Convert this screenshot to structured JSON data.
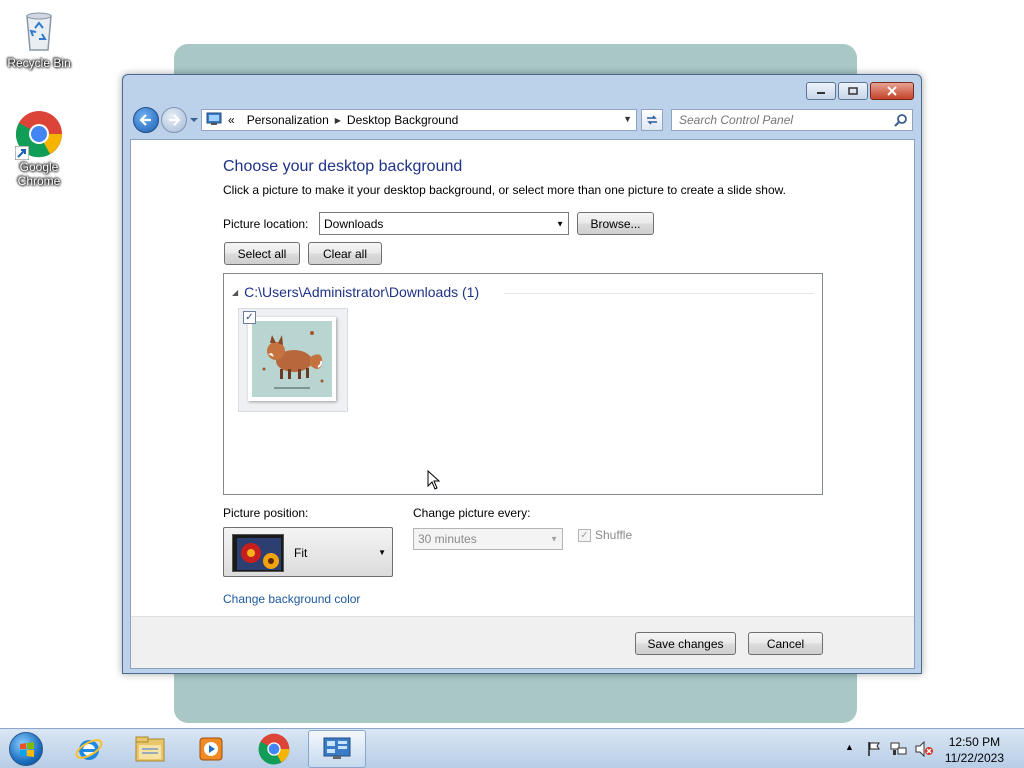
{
  "desktop": {
    "icons": [
      {
        "label": "Recycle Bin",
        "icon": "recycle-bin-icon"
      },
      {
        "label": "Google Chrome",
        "icon": "chrome-icon"
      }
    ]
  },
  "window": {
    "breadcrumb": {
      "overflow": "«",
      "items": [
        "Personalization",
        "Desktop Background"
      ]
    },
    "search_placeholder": "Search Control Panel",
    "title": "Choose your desktop background",
    "subtitle": "Click a picture to make it your desktop background, or select more than one picture to create a slide show.",
    "picture_location": {
      "label": "Picture location:",
      "value": "Downloads",
      "browse_label": "Browse..."
    },
    "select_all_label": "Select all",
    "clear_all_label": "Clear all",
    "gallery": {
      "group_header": "C:\\Users\\Administrator\\Downloads (1)",
      "items": [
        {
          "name": "fox-wallpaper",
          "checked": true
        }
      ]
    },
    "picture_position": {
      "label": "Picture position:",
      "value": "Fit"
    },
    "change_picture": {
      "label": "Change picture every:",
      "value": "30 minutes",
      "shuffle_label": "Shuffle",
      "shuffle_checked": true,
      "disabled": true
    },
    "change_bg_color_link": "Change background color",
    "save_label": "Save changes",
    "cancel_label": "Cancel"
  },
  "taskbar": {
    "apps": [
      {
        "name": "internet-explorer",
        "icon": "ie-icon"
      },
      {
        "name": "file-explorer",
        "icon": "folder-icon"
      },
      {
        "name": "media-player",
        "icon": "media-player-icon"
      },
      {
        "name": "chrome",
        "icon": "chrome-icon"
      },
      {
        "name": "control-panel",
        "icon": "control-panel-icon",
        "active": true
      }
    ],
    "clock": {
      "time": "12:50 PM",
      "date": "11/22/2023"
    }
  },
  "colors": {
    "accent_title": "#1e3287",
    "link": "#1e5aa0",
    "wallpaper": "#a8c7c5",
    "window_frame": "#bcd1ea"
  }
}
